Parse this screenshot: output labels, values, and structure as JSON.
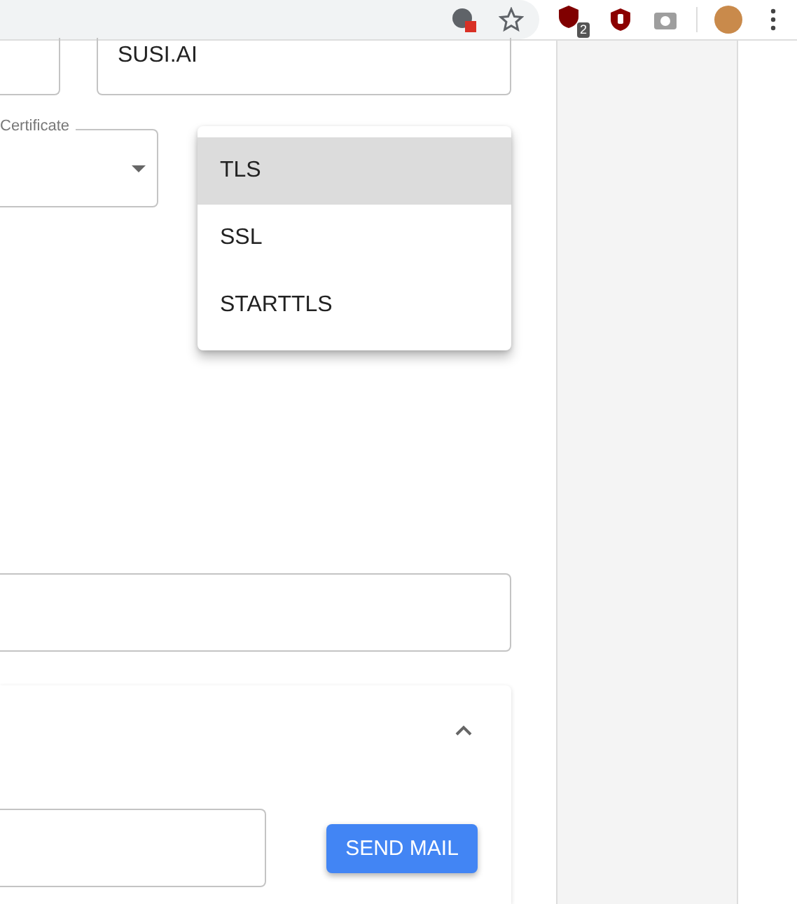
{
  "toolbar": {
    "extension_badge": "2"
  },
  "organization_field": {
    "value": "SUSI.AI"
  },
  "certificate_select": {
    "label": "Certificate"
  },
  "certificate_menu": [
    {
      "label": "TLS",
      "selected": true
    },
    {
      "label": "SSL",
      "selected": false
    },
    {
      "label": "STARTTLS",
      "selected": false
    }
  ],
  "test_card": {
    "expanded": true,
    "button": "SEND MAIL"
  }
}
